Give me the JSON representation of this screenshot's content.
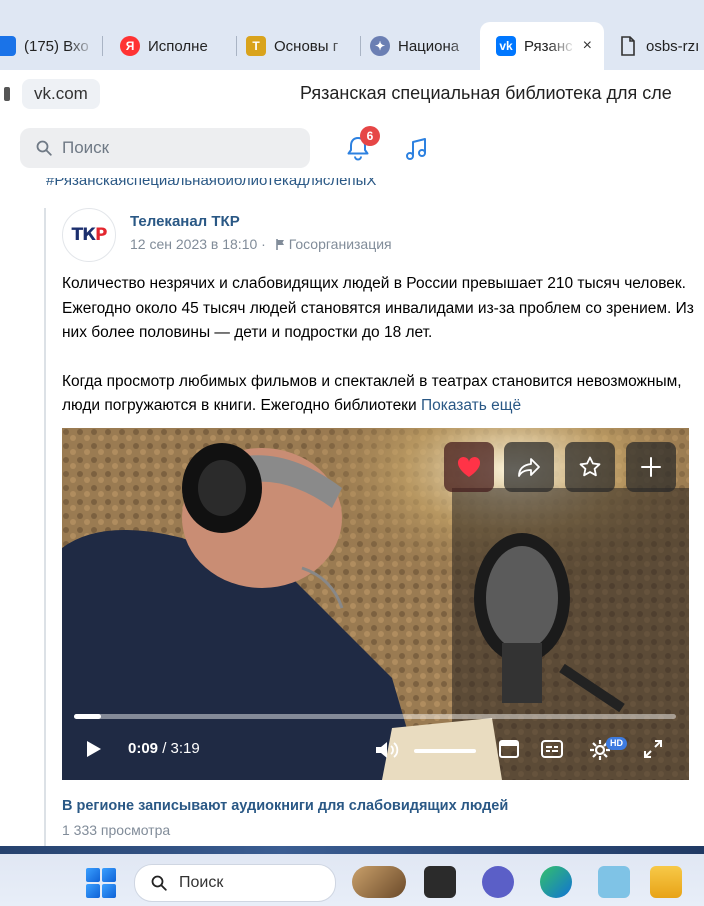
{
  "browser": {
    "tabs": [
      {
        "label": "(175) Вхо",
        "icon": "mail-icon"
      },
      {
        "label": "Исполне",
        "icon": "yandex-icon"
      },
      {
        "label": "Основы г",
        "icon": "emblem-icon"
      },
      {
        "label": "Национа",
        "icon": "eagle-icon"
      },
      {
        "label": "Рязанс",
        "icon": "vk-icon",
        "active": true
      },
      {
        "label": "osbs-rzı",
        "icon": "document-icon"
      }
    ],
    "close_glyph": "×",
    "address": "vk.com",
    "page_title": "Рязанская специальная библиотека для сле"
  },
  "vk_header": {
    "search_placeholder": "Поиск",
    "notifications_count": "6"
  },
  "feed": {
    "hashtag": "#РязанскаяспециальнаябиблиотекадляслепыХ",
    "post": {
      "author": "Телеканал ТКР",
      "avatar_logo": {
        "t": "Т",
        "k": "К",
        "r": "Р"
      },
      "date": "12 сен 2023 в 18:10",
      "dot": "·",
      "org_label": "Госорганизация",
      "paragraph1": "Количество незрячих и слабовидящих людей в России превышает 210 тысяч человек. Ежегодно около 45 тысяч людей становятся инвалидами из-за проблем со зрением. Из них более половины — дети и подростки до 18 лет.",
      "paragraph2_start": "Когда просмотр любимых фильмов и спектаклей в театрах становится невозможным, люди погружаются в книги. Ежегодно библиотеки",
      "paragraph2_faded": "",
      "show_more": "Показать ещё",
      "video": {
        "current_time": "0:09",
        "separator": " / ",
        "duration": "3:19",
        "progress": 0.045,
        "hd_badge": "HD",
        "title": "В регионе записывают аудиокниги для слабовидящих людей",
        "views": "1 333 просмотра"
      }
    }
  },
  "taskbar": {
    "search_placeholder": "Поиск"
  },
  "colors": {
    "vk_link": "#2a5885",
    "badge_red": "#e64646",
    "tkr_blue": "#1c2f6e",
    "tkr_red": "#e3262e"
  }
}
